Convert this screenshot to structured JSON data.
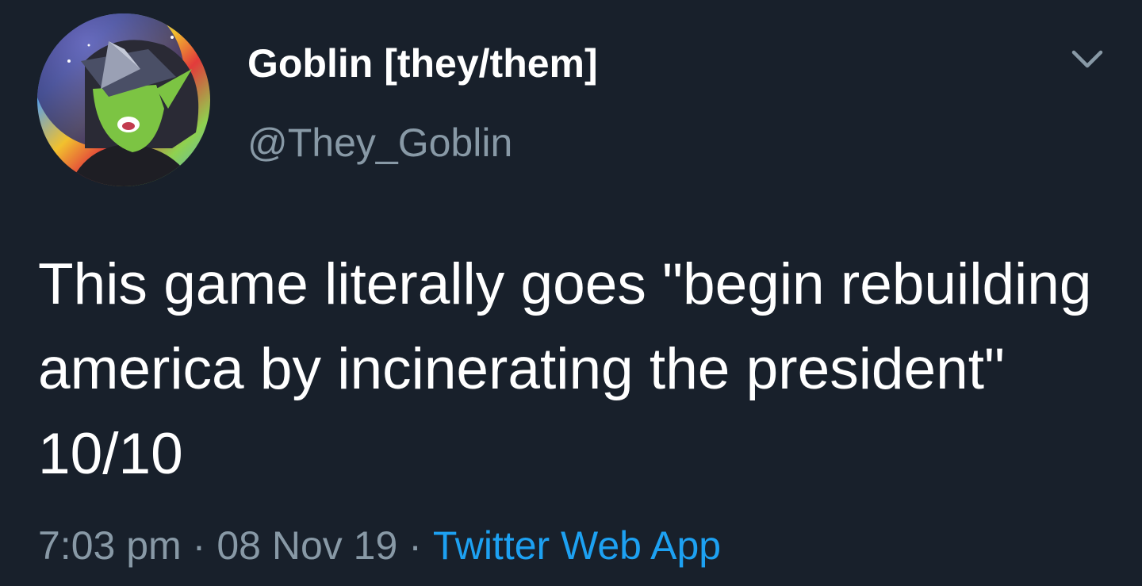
{
  "author": {
    "display_name": "Goblin [they/them]",
    "handle": "@They_Goblin",
    "avatar_icon": "goblin-vr-headset-avatar"
  },
  "tweet": {
    "text": "This game literally goes \"begin rebuilding america by incinerating the president\" 10/10",
    "time": "7:03 pm",
    "date": "08 Nov 19",
    "separator": "·",
    "source": "Twitter Web App"
  },
  "icons": {
    "menu": "chevron-down-icon"
  },
  "colors": {
    "background": "#18202b",
    "primary_text": "#ffffff",
    "secondary_text": "#8899a6",
    "link": "#1da1f2"
  }
}
